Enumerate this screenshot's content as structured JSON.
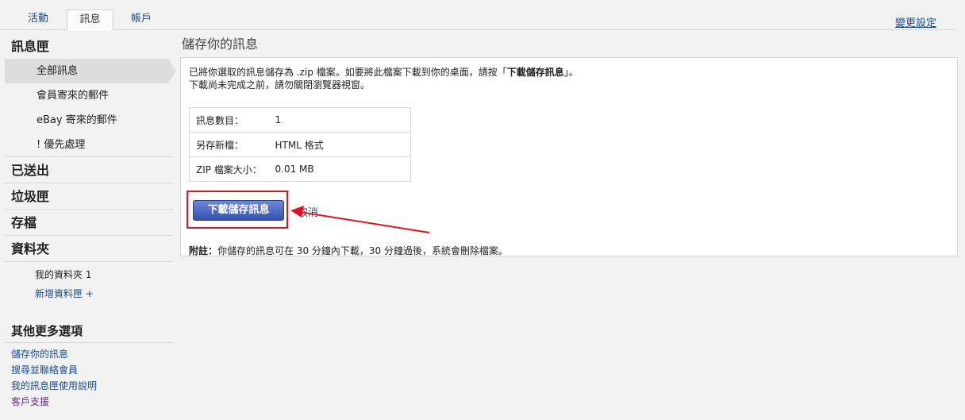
{
  "tabs": [
    {
      "label": "活動"
    },
    {
      "label": "訊息"
    },
    {
      "label": "帳戶"
    }
  ],
  "settings_link": "變更設定",
  "sidebar": {
    "inbox_title": "訊息匣",
    "inbox_items": [
      {
        "label": "全部訊息"
      },
      {
        "label": "會員寄來的郵件"
      },
      {
        "label": "eBay 寄來的郵件"
      },
      {
        "label": "! 優先處理"
      }
    ],
    "sent_title": "已送出",
    "trash_title": "垃圾匣",
    "archive_title": "存檔",
    "folders_title": "資料夾",
    "folder_items": [
      {
        "label": "我的資料夾 1"
      },
      {
        "label": "新增資料匣 +"
      }
    ],
    "more_title": "其他更多選項",
    "more_links": [
      {
        "label": "儲存你的訊息"
      },
      {
        "label": "搜尋並聯絡會員"
      },
      {
        "label": "我的訊息匣使用說明"
      },
      {
        "label": "客戶支援"
      }
    ]
  },
  "main": {
    "page_title": "儲存你的訊息",
    "intro_line1_pre": "已將你選取的訊息儲存為 .zip 檔案。如要將此檔案下載到你的桌面，請按「",
    "intro_line1_bold": "下載儲存訊息",
    "intro_line1_post": "」。",
    "intro_line2": "下載尚未完成之前，請勿關閉瀏覽器視窗。",
    "info": [
      {
        "label": "訊息數目：",
        "value": "1"
      },
      {
        "label": "另存新檔：",
        "value": "HTML 格式"
      },
      {
        "label": "ZIP 檔案大小：",
        "value": "0.01 MB"
      }
    ],
    "download_button": "下載儲存訊息",
    "cancel_link": "取消",
    "note_bold": "附註：",
    "note_text": "你儲存的訊息可在 30 分鐘內下載，30 分鐘過後，系統會刪除檔案。"
  },
  "colors": {
    "link": "#1a4a8a",
    "button_top": "#6f87d6",
    "button_bottom": "#3350b0",
    "highlight": "#e0141e"
  }
}
